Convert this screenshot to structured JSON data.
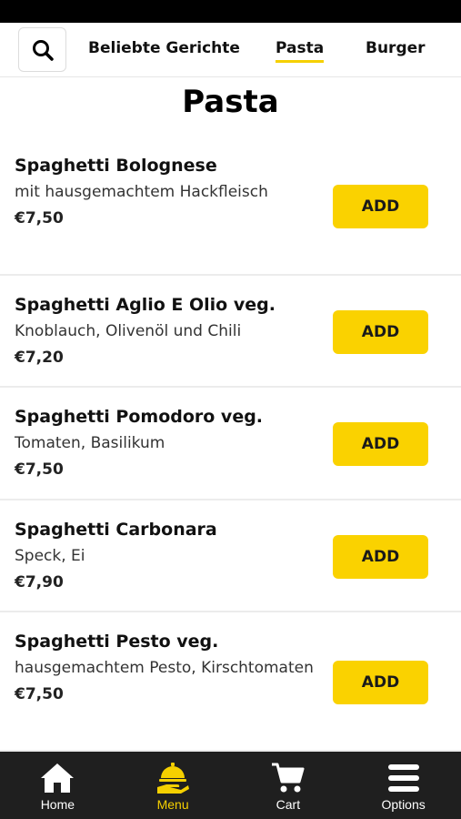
{
  "categories": {
    "search_icon": "search-icon",
    "tabs": [
      {
        "label": "Beliebte Gerichte",
        "active": false
      },
      {
        "label": "Pasta",
        "active": true
      },
      {
        "label": "Burger",
        "active": false
      }
    ]
  },
  "page": {
    "title": "Pasta"
  },
  "menu": {
    "add_label": "ADD",
    "items": [
      {
        "name": "Spaghetti Bolognese",
        "description": "mit hausgemachtem Hackfleisch",
        "price": "€7,50"
      },
      {
        "name": "Spaghetti Aglio E Olio veg.",
        "description": "Knoblauch, Olivenöl und Chili",
        "price": "€7,20"
      },
      {
        "name": "Spaghetti Pomodoro veg.",
        "description": "Tomaten, Basilikum",
        "price": "€7,50"
      },
      {
        "name": "Spaghetti Carbonara",
        "description": "Speck, Ei",
        "price": "€7,90"
      },
      {
        "name": "Spaghetti Pesto veg.",
        "description": "hausgemachtem Pesto, Kirschtomaten",
        "price": "€7,50"
      }
    ]
  },
  "bottom_nav": {
    "items": [
      {
        "label": "Home",
        "icon": "home-icon",
        "active": false
      },
      {
        "label": "Menu",
        "icon": "serving-hand-icon",
        "active": true
      },
      {
        "label": "Cart",
        "icon": "cart-icon",
        "active": false
      },
      {
        "label": "Options",
        "icon": "menu-lines-icon",
        "active": false
      }
    ]
  },
  "colors": {
    "accent": "#fad200",
    "nav_background": "#1f1f1f",
    "status_bar": "#000000"
  }
}
